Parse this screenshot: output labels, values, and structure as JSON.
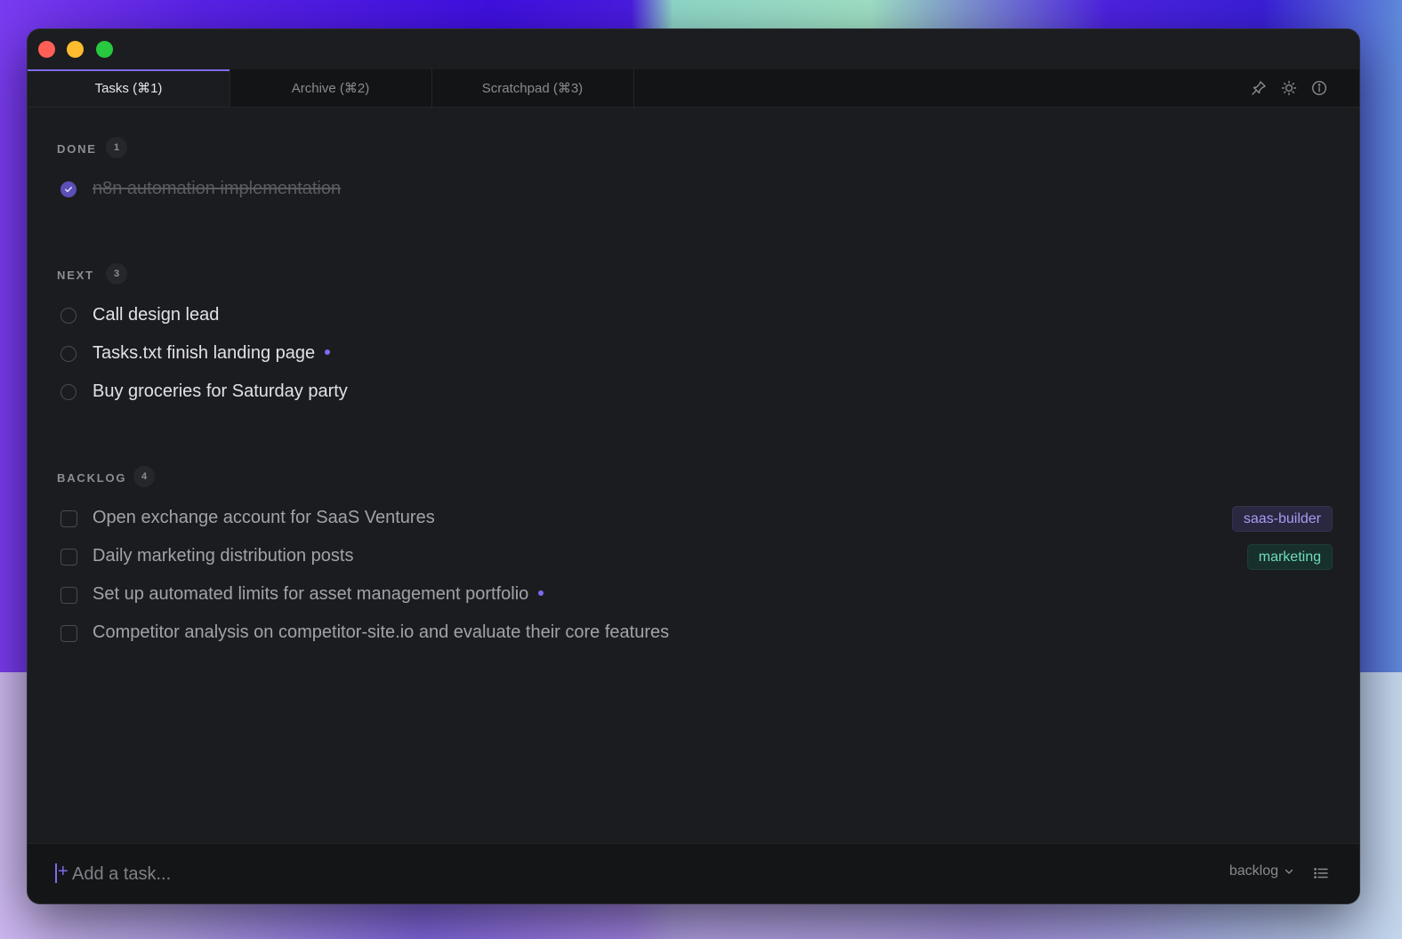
{
  "tabs": [
    {
      "label": "Tasks (⌘1)",
      "active": true
    },
    {
      "label": "Archive (⌘2)",
      "active": false
    },
    {
      "label": "Scratchpad (⌘3)",
      "active": false
    }
  ],
  "toolbar_icons": [
    "pin-icon",
    "sun-icon",
    "info-icon"
  ],
  "sections": {
    "done": {
      "title": "DONE",
      "count": "1",
      "items": [
        {
          "text": "n8n automation implementation"
        }
      ]
    },
    "next": {
      "title": "NEXT",
      "count": "3",
      "items": [
        {
          "text": "Call design lead"
        },
        {
          "text": "Tasks.txt finish landing page",
          "has_note_dot": true
        },
        {
          "text": "Buy groceries for Saturday party"
        }
      ]
    },
    "backlog": {
      "title": "BACKLOG",
      "count": "4",
      "items": [
        {
          "text": "Open exchange account for SaaS Ventures",
          "tag": "saas-builder"
        },
        {
          "text": "Daily marketing distribution posts",
          "tag": "marketing"
        },
        {
          "text": "Set up automated limits for asset management portfolio",
          "has_note_dot": true
        },
        {
          "text": "Competitor analysis on competitor-site.io and evaluate their core features"
        }
      ]
    }
  },
  "footer": {
    "plus": "+",
    "add_placeholder": "Add a task...",
    "target_list": "backlog"
  },
  "colors": {
    "accent": "#7c6cf0",
    "tag_purple": "#a79cf2",
    "tag_green": "#6fdcbf",
    "window_bg": "#1b1c1f"
  }
}
